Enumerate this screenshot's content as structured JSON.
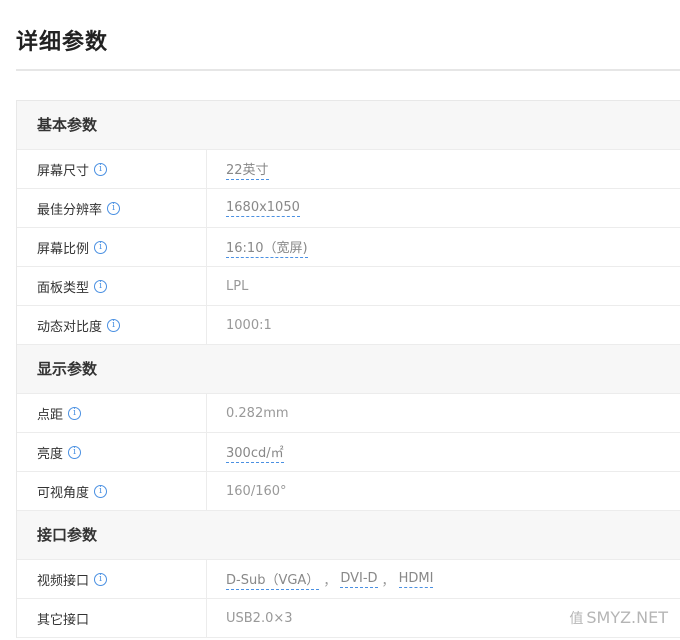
{
  "page_title": "详细参数",
  "sections": [
    {
      "title": "基本参数",
      "rows": [
        {
          "label": "屏幕尺寸",
          "value": "22英寸"
        },
        {
          "label": "最佳分辨率",
          "value": "1680x1050"
        },
        {
          "label": "屏幕比例",
          "value": "16:10（宽屏)"
        },
        {
          "label": "面板类型",
          "value": "LPL"
        },
        {
          "label": "动态对比度",
          "value": "1000:1"
        }
      ]
    },
    {
      "title": "显示参数",
      "rows": [
        {
          "label": "点距",
          "value": "0.282mm"
        },
        {
          "label": "亮度",
          "value": "300cd/㎡"
        },
        {
          "label": "可视角度",
          "value": "160/160°"
        }
      ]
    },
    {
      "title": "接口参数",
      "rows": [
        {
          "label": "视频接口",
          "value_parts": [
            "D-Sub（VGA）",
            "DVI-D",
            "HDMI"
          ],
          "separators": [
            "，",
            "，"
          ]
        },
        {
          "label": "其它接口",
          "value": "USB2.0×3"
        }
      ]
    }
  ],
  "info_icon": "i",
  "watermark": {
    "icon": "值",
    "text": "SMYZ.NET"
  },
  "colors": {
    "link_underline": "#4a90e2",
    "section_bg": "#f7f7f7"
  }
}
